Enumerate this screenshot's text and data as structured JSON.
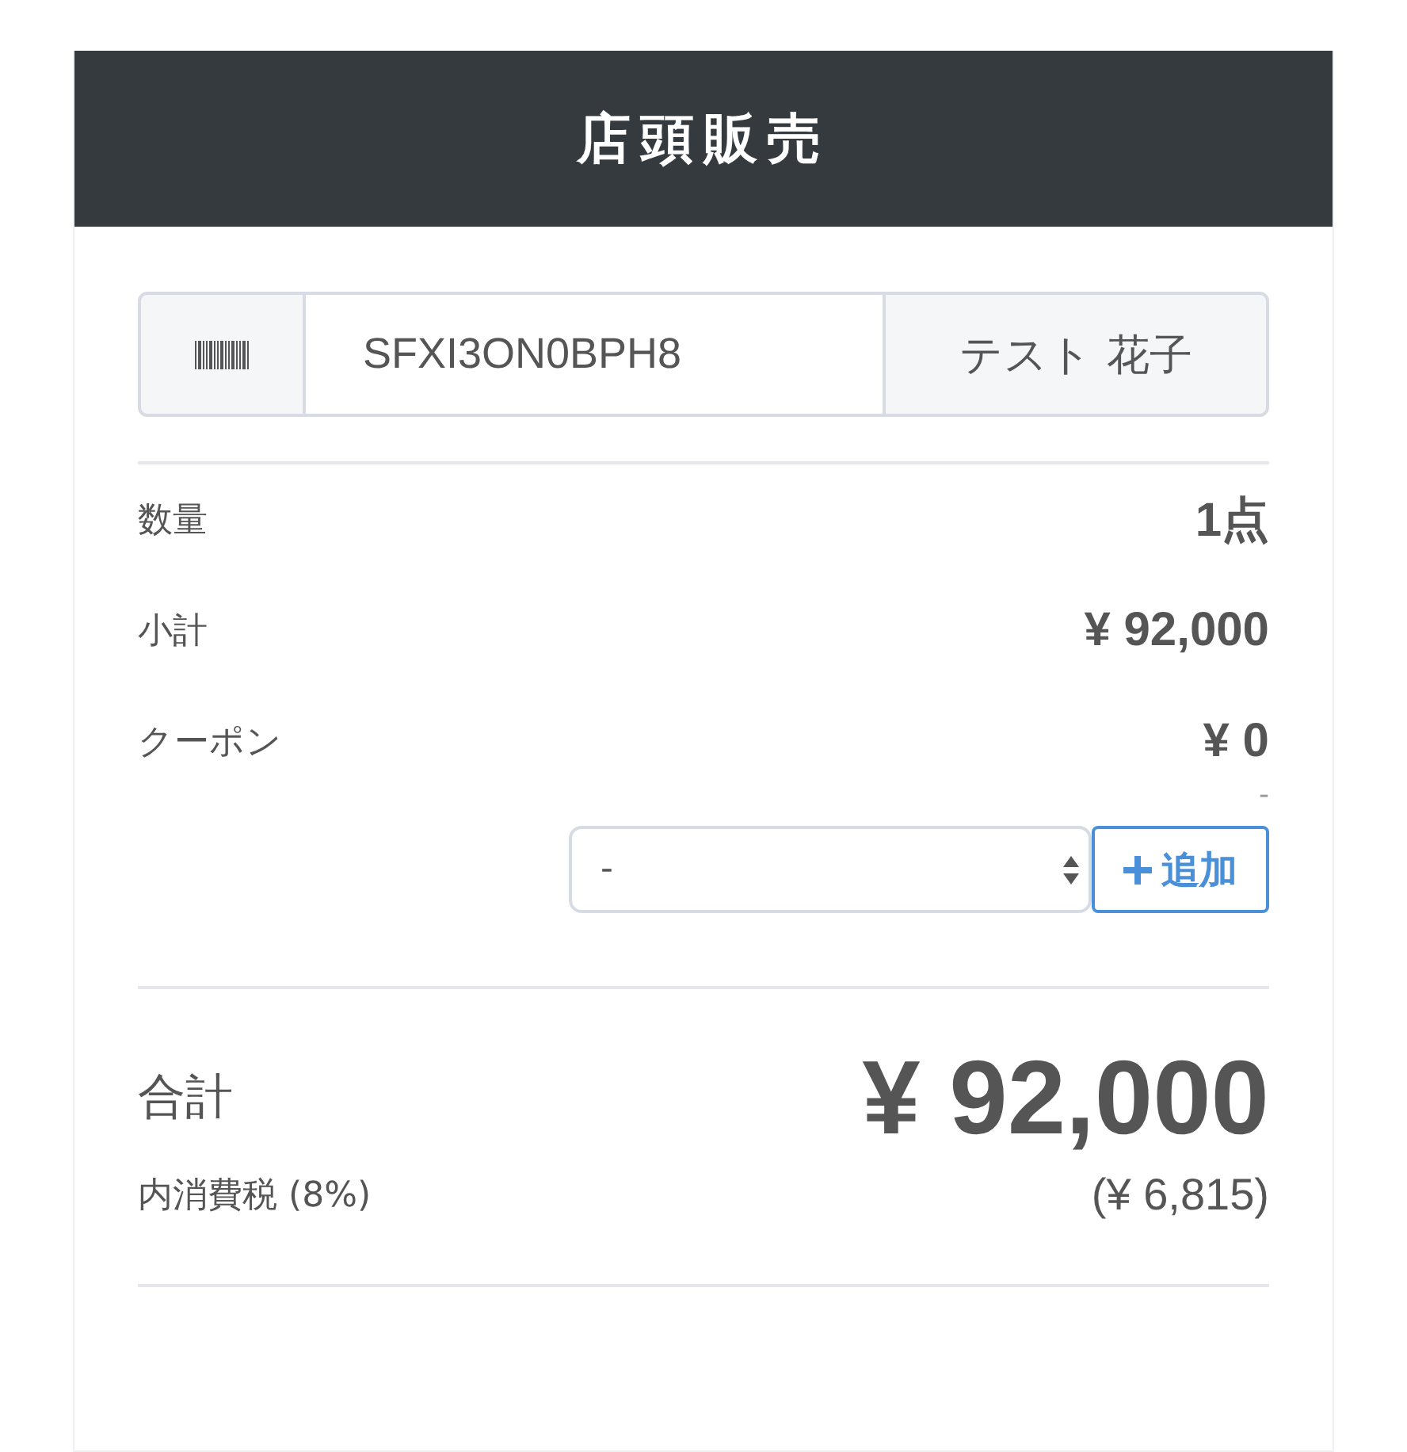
{
  "header": {
    "title": "店頭販売"
  },
  "scan": {
    "value": "SFXI3ON0BPH8",
    "customer": "テスト 花子"
  },
  "rows": [
    {
      "label": "数量",
      "value": "1点"
    },
    {
      "label": "小計",
      "value": "¥ 92,000"
    },
    {
      "label": "クーポン",
      "value": "¥ 0"
    }
  ],
  "coupon": {
    "note": "-",
    "select_value": "-",
    "add_button": "追加"
  },
  "total": {
    "label": "合計",
    "value": "¥ 92,000"
  },
  "tax": {
    "label": "内消費税 (8%)",
    "value": "(¥ 6,815)"
  }
}
